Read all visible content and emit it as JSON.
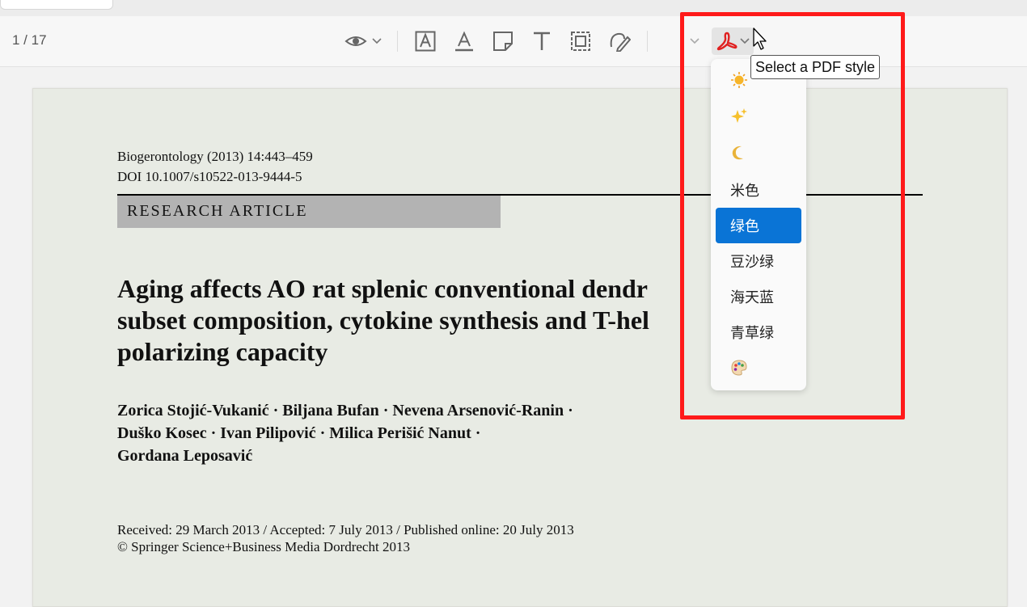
{
  "toolbar": {
    "page_indicator": "1 / 17",
    "pdf_style_tooltip": "Select a PDF style"
  },
  "icons": {
    "view": "eye-icon",
    "highlight_text": "text-box-icon",
    "underline_text": "text-underline-icon",
    "note": "sticky-note-icon",
    "add_text": "text-icon",
    "area_select": "area-select-icon",
    "sign": "signature-icon",
    "pdf_style": "acrobat-icon"
  },
  "style_menu": {
    "items": [
      {
        "label": "",
        "icon": "sun-icon"
      },
      {
        "label": "",
        "icon": "sparkles-icon"
      },
      {
        "label": "",
        "icon": "moon-icon"
      },
      {
        "label": "米色"
      },
      {
        "label": "绿色",
        "selected": true
      },
      {
        "label": "豆沙绿"
      },
      {
        "label": "海天蓝"
      },
      {
        "label": "青草绿"
      },
      {
        "label": "",
        "icon": "palette-icon"
      }
    ]
  },
  "document": {
    "journal_line": "Biogerontology (2013) 14:443–459",
    "doi_line": "DOI 10.1007/s10522-013-9444-5",
    "article_type": "RESEARCH ARTICLE",
    "title_lines": [
      "Aging affects AO rat splenic conventional dendr",
      "subset composition, cytokine synthesis and T-hel",
      "polarizing capacity"
    ],
    "author_lines": [
      "Zorica Stojić-Vukanić · Biljana Bufan · Nevena Arsenović-Ranin ·",
      "Duško Kosec · Ivan Pilipović · Milica Perišić Nanut ·",
      "Gordana Leposavić"
    ],
    "dates_line": "Received: 29 March 2013 / Accepted: 7 July 2013 / Published online: 20 July 2013",
    "copyright_line": "© Springer Science+Business Media Dordrecht 2013"
  },
  "colors": {
    "page_background": "#e8ebe4",
    "selected_item": "#0a74d6",
    "highlight_frame": "#ff1a1a",
    "acrobat_red": "#e02020"
  }
}
